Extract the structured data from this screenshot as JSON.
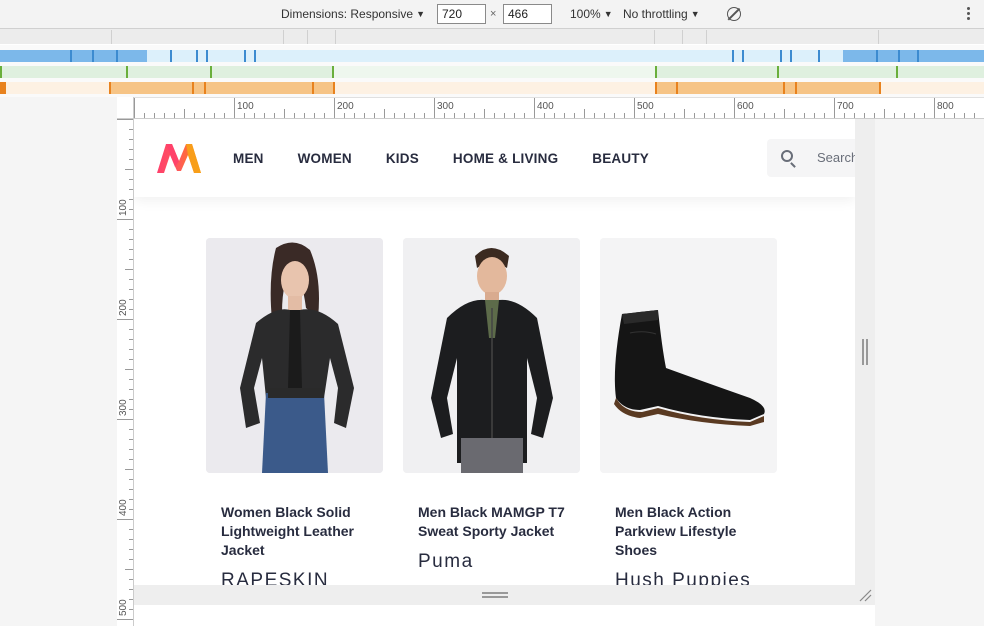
{
  "devtools": {
    "dimensions_label": "Dimensions: Responsive",
    "width_value": "720",
    "height_value": "466",
    "times": "×",
    "zoom": "100%",
    "throttling": "No throttling"
  },
  "ruler": {
    "top_labels": [
      "100",
      "200",
      "300",
      "400",
      "500",
      "600",
      "700",
      "800"
    ],
    "left_labels": [
      "100",
      "200",
      "300",
      "400",
      "500"
    ]
  },
  "colors": {
    "brand_pink": "#ff3f6c",
    "brand_orange": "#ff8a00",
    "mq_blue": "#7cb8ea",
    "mq_green": "#6aaf3c",
    "mq_orange": "#f0a64a",
    "text_dark": "#282c3f"
  },
  "site": {
    "nav": [
      {
        "label": "MEN"
      },
      {
        "label": "WOMEN"
      },
      {
        "label": "KIDS"
      },
      {
        "label": "HOME & LIVING"
      },
      {
        "label": "BEAUTY"
      }
    ],
    "search_placeholder": "Search"
  },
  "products": [
    {
      "name": "Women Black Solid Lightweight Leather Jacket",
      "brand": "RAPESKIN",
      "image": "woman-leather-jacket"
    },
    {
      "name": "Men Black MAMGP T7 Sweat Sporty Jacket",
      "brand": "Puma",
      "image": "man-sport-jacket"
    },
    {
      "name": "Men Black Action Parkview Lifestyle Shoes",
      "brand": "Hush Puppies",
      "image": "black-chelsea-boot"
    }
  ]
}
